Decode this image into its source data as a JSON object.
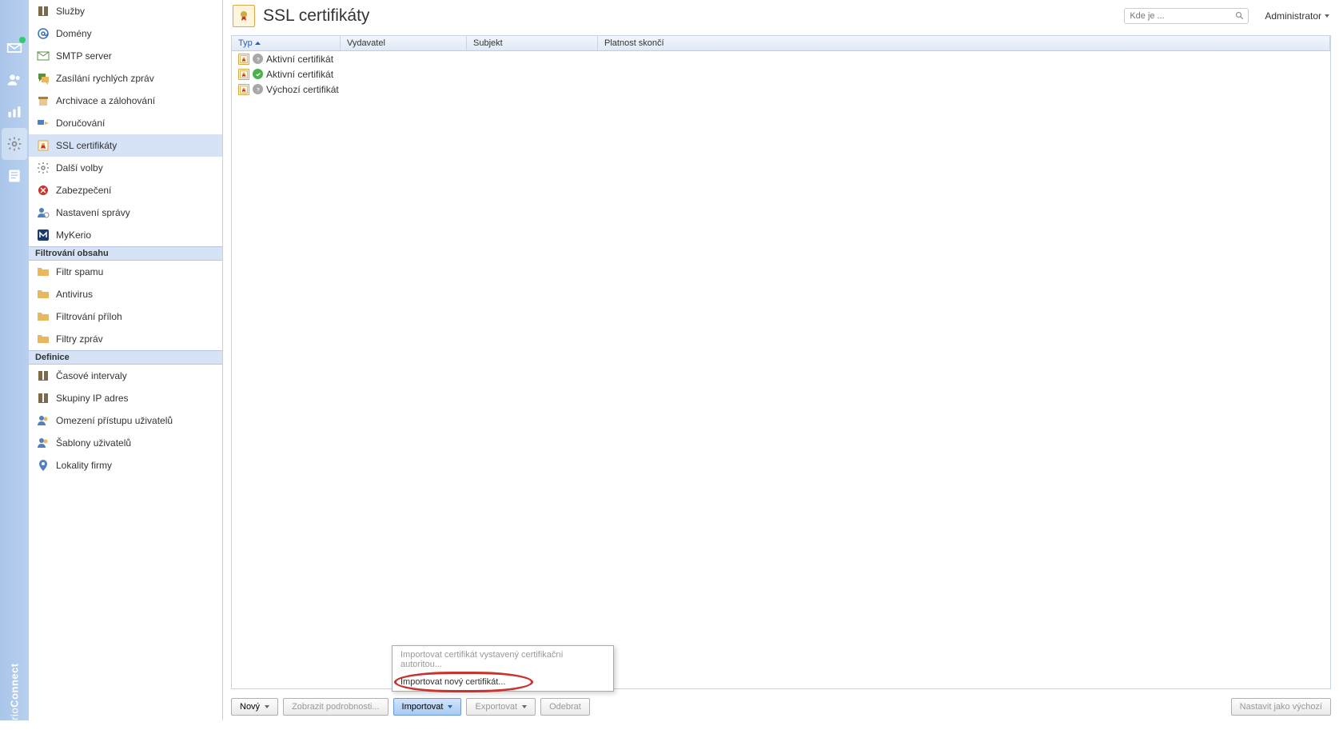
{
  "header": {
    "title": "SSL certifikáty",
    "search_placeholder": "Kde je ...",
    "user_label": "Administrator"
  },
  "sidebar": {
    "items": [
      {
        "label": "Služby",
        "icon": "book"
      },
      {
        "label": "Domény",
        "icon": "at"
      },
      {
        "label": "SMTP server",
        "icon": "mail"
      },
      {
        "label": "Zasílání rychlých zpráv",
        "icon": "chat"
      },
      {
        "label": "Archivace a zálohování",
        "icon": "archive"
      },
      {
        "label": "Doručování",
        "icon": "deliver"
      },
      {
        "label": "SSL certifikáty",
        "icon": "cert",
        "selected": true
      },
      {
        "label": "Další volby",
        "icon": "gear"
      },
      {
        "label": "Zabezpečení",
        "icon": "shield"
      },
      {
        "label": "Nastavení správy",
        "icon": "admin"
      },
      {
        "label": "MyKerio",
        "icon": "mykerio"
      }
    ],
    "group2_header": "Filtrování obsahu",
    "group2_items": [
      {
        "label": "Filtr spamu",
        "icon": "folder"
      },
      {
        "label": "Antivirus",
        "icon": "folder"
      },
      {
        "label": "Filtrování příloh",
        "icon": "folder"
      },
      {
        "label": "Filtry zpráv",
        "icon": "folder"
      }
    ],
    "group3_header": "Definice",
    "group3_items": [
      {
        "label": "Časové intervaly",
        "icon": "book"
      },
      {
        "label": "Skupiny IP adres",
        "icon": "book"
      },
      {
        "label": "Omezení přístupu uživatelů",
        "icon": "users"
      },
      {
        "label": "Šablony uživatelů",
        "icon": "users"
      },
      {
        "label": "Lokality firmy",
        "icon": "loc"
      }
    ]
  },
  "table": {
    "columns": {
      "type": "Typ",
      "issuer": "Vydavatel",
      "subject": "Subjekt",
      "expires": "Platnost skončí"
    },
    "rows": [
      {
        "status": "gray",
        "name": "Aktivní certifikát"
      },
      {
        "status": "green",
        "name": "Aktivní certifikát"
      },
      {
        "status": "gray",
        "name": "Výchozí certifikát"
      }
    ]
  },
  "toolbar": {
    "new": "Nový",
    "details": "Zobrazit podrobnosti...",
    "import": "Importovat",
    "export": "Exportovat",
    "remove": "Odebrat",
    "set_default": "Nastavit jako výchozí"
  },
  "popup": {
    "item1": "Importovat certifikát vystavený certifikační autoritou...",
    "item2": "Importovat nový certifikát..."
  },
  "vnav_logo_prefix": "Kerio",
  "vnav_logo_suffix": "Connect"
}
